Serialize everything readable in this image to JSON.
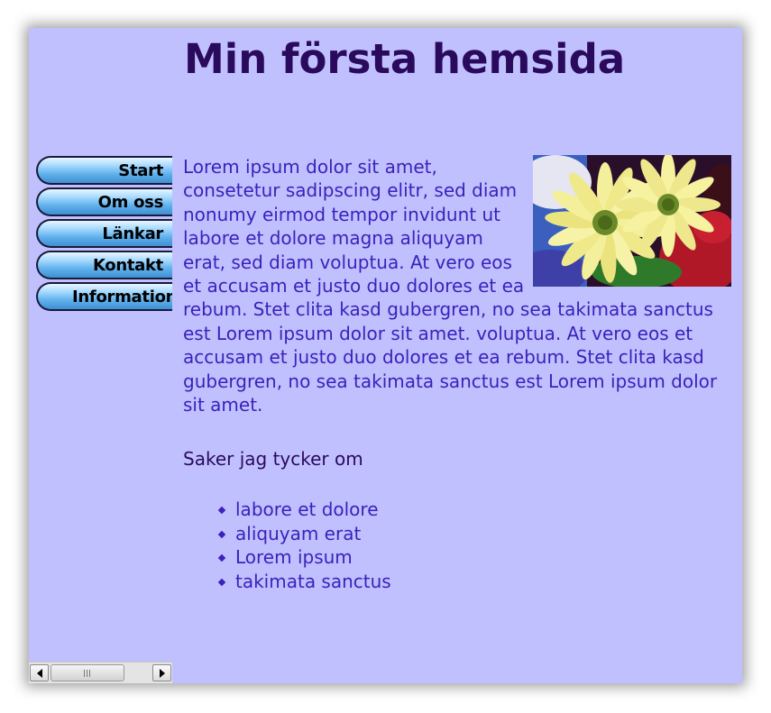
{
  "header": {
    "title": "Min första hemsida"
  },
  "nav": {
    "items": [
      {
        "label": "Start"
      },
      {
        "label": "Om oss"
      },
      {
        "label": "Länkar"
      },
      {
        "label": "Kontakt"
      },
      {
        "label": "Information"
      }
    ]
  },
  "main": {
    "paragraph": "Lorem ipsum dolor sit amet, consetetur sadipscing elitr, sed diam nonumy eirmod tempor invidunt ut labore et dolore magna aliquyam erat, sed diam voluptua. At vero eos et accusam et justo duo dolores et ea rebum. Stet clita kasd gubergren, no sea takimata sanctus est Lorem ipsum dolor sit amet. voluptua. At vero eos et accusam et justo duo dolores et ea rebum. Stet clita kasd gubergren, no sea takimata sanctus est Lorem ipsum dolor sit amet.",
    "subheading": "Saker jag tycker om",
    "list": [
      "labore et dolore",
      "aliquyam erat",
      "Lorem ipsum",
      "takimata sanctus"
    ]
  },
  "icons": {
    "image": "flower-photo",
    "scroll_left": "arrow-left-icon",
    "scroll_right": "arrow-right-icon",
    "thumb": "grip-icon"
  },
  "colors": {
    "page_background": "#c0c0ff",
    "title_text": "#2a0a5c",
    "body_text": "#3a22bb",
    "nav_button": "#5fb0ec"
  }
}
